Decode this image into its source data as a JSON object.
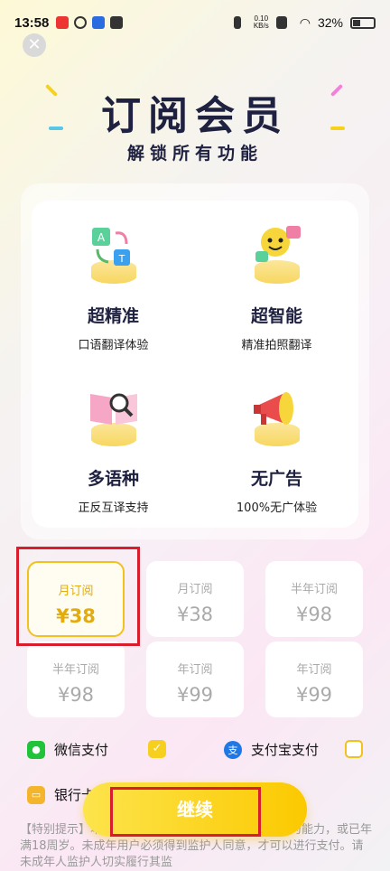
{
  "status": {
    "time": "13:58",
    "net_speed_top": "0.10",
    "net_speed_bottom": "KB/s",
    "battery": "32%"
  },
  "close_label": "✕",
  "header": {
    "title": "订阅会员",
    "subtitle": "解锁所有功能"
  },
  "features": [
    {
      "name": "超精准",
      "desc": "口语翻译体验",
      "icon": "translate-cards-icon"
    },
    {
      "name": "超智能",
      "desc": "精准拍照翻译",
      "icon": "smiley-bubble-icon"
    },
    {
      "name": "多语种",
      "desc": "正反互译支持",
      "icon": "book-magnifier-icon"
    },
    {
      "name": "无广告",
      "desc": "100%无广体验",
      "icon": "megaphone-icon"
    }
  ],
  "plans": [
    {
      "name": "月订阅",
      "price": "¥38"
    },
    {
      "name": "月订阅",
      "price": "¥38"
    },
    {
      "name": "半年订阅",
      "price": "¥98"
    },
    {
      "name": "半年订阅",
      "price": "¥98"
    },
    {
      "name": "年订阅",
      "price": "¥99"
    },
    {
      "name": "年订阅",
      "price": "¥99"
    }
  ],
  "payments": {
    "wechat": "微信支付",
    "alipay": "支付宝支付",
    "bank": "银行卡"
  },
  "cta_label": "继续",
  "notice": "【特别提示】本应用平台需确认自己具有完全民事行为能力，或已年满18周岁。未成年用户必须得到监护人同意，才可以进行支付。请未成年人监护人切实履行其监",
  "colors": {
    "accent": "#f1c21b",
    "highlight": "#d81d2c",
    "wechat": "#21c33b",
    "alipay": "#1e78e6",
    "bank": "#f4b52c"
  }
}
